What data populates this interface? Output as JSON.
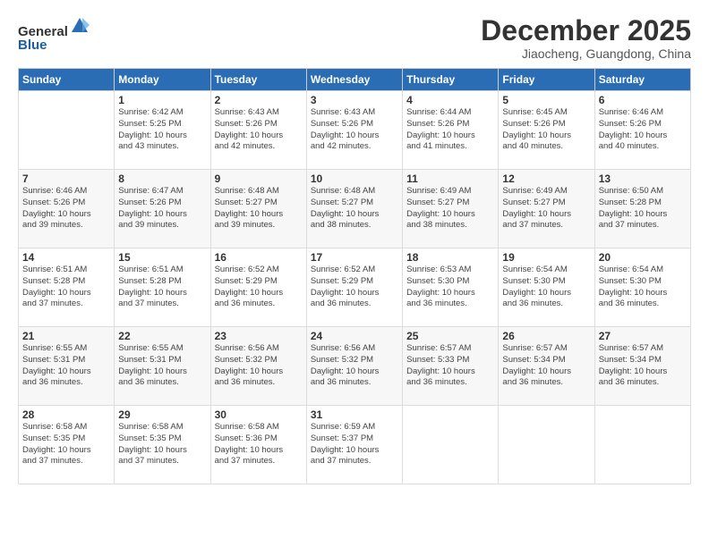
{
  "logo": {
    "general": "General",
    "blue": "Blue"
  },
  "header": {
    "month": "December 2025",
    "location": "Jiaocheng, Guangdong, China"
  },
  "weekdays": [
    "Sunday",
    "Monday",
    "Tuesday",
    "Wednesday",
    "Thursday",
    "Friday",
    "Saturday"
  ],
  "weeks": [
    [
      {
        "day": "",
        "info": ""
      },
      {
        "day": "1",
        "info": "Sunrise: 6:42 AM\nSunset: 5:25 PM\nDaylight: 10 hours\nand 43 minutes."
      },
      {
        "day": "2",
        "info": "Sunrise: 6:43 AM\nSunset: 5:26 PM\nDaylight: 10 hours\nand 42 minutes."
      },
      {
        "day": "3",
        "info": "Sunrise: 6:43 AM\nSunset: 5:26 PM\nDaylight: 10 hours\nand 42 minutes."
      },
      {
        "day": "4",
        "info": "Sunrise: 6:44 AM\nSunset: 5:26 PM\nDaylight: 10 hours\nand 41 minutes."
      },
      {
        "day": "5",
        "info": "Sunrise: 6:45 AM\nSunset: 5:26 PM\nDaylight: 10 hours\nand 40 minutes."
      },
      {
        "day": "6",
        "info": "Sunrise: 6:46 AM\nSunset: 5:26 PM\nDaylight: 10 hours\nand 40 minutes."
      }
    ],
    [
      {
        "day": "7",
        "info": "Sunrise: 6:46 AM\nSunset: 5:26 PM\nDaylight: 10 hours\nand 39 minutes."
      },
      {
        "day": "8",
        "info": "Sunrise: 6:47 AM\nSunset: 5:26 PM\nDaylight: 10 hours\nand 39 minutes."
      },
      {
        "day": "9",
        "info": "Sunrise: 6:48 AM\nSunset: 5:27 PM\nDaylight: 10 hours\nand 39 minutes."
      },
      {
        "day": "10",
        "info": "Sunrise: 6:48 AM\nSunset: 5:27 PM\nDaylight: 10 hours\nand 38 minutes."
      },
      {
        "day": "11",
        "info": "Sunrise: 6:49 AM\nSunset: 5:27 PM\nDaylight: 10 hours\nand 38 minutes."
      },
      {
        "day": "12",
        "info": "Sunrise: 6:49 AM\nSunset: 5:27 PM\nDaylight: 10 hours\nand 37 minutes."
      },
      {
        "day": "13",
        "info": "Sunrise: 6:50 AM\nSunset: 5:28 PM\nDaylight: 10 hours\nand 37 minutes."
      }
    ],
    [
      {
        "day": "14",
        "info": "Sunrise: 6:51 AM\nSunset: 5:28 PM\nDaylight: 10 hours\nand 37 minutes."
      },
      {
        "day": "15",
        "info": "Sunrise: 6:51 AM\nSunset: 5:28 PM\nDaylight: 10 hours\nand 37 minutes."
      },
      {
        "day": "16",
        "info": "Sunrise: 6:52 AM\nSunset: 5:29 PM\nDaylight: 10 hours\nand 36 minutes."
      },
      {
        "day": "17",
        "info": "Sunrise: 6:52 AM\nSunset: 5:29 PM\nDaylight: 10 hours\nand 36 minutes."
      },
      {
        "day": "18",
        "info": "Sunrise: 6:53 AM\nSunset: 5:30 PM\nDaylight: 10 hours\nand 36 minutes."
      },
      {
        "day": "19",
        "info": "Sunrise: 6:54 AM\nSunset: 5:30 PM\nDaylight: 10 hours\nand 36 minutes."
      },
      {
        "day": "20",
        "info": "Sunrise: 6:54 AM\nSunset: 5:30 PM\nDaylight: 10 hours\nand 36 minutes."
      }
    ],
    [
      {
        "day": "21",
        "info": "Sunrise: 6:55 AM\nSunset: 5:31 PM\nDaylight: 10 hours\nand 36 minutes."
      },
      {
        "day": "22",
        "info": "Sunrise: 6:55 AM\nSunset: 5:31 PM\nDaylight: 10 hours\nand 36 minutes."
      },
      {
        "day": "23",
        "info": "Sunrise: 6:56 AM\nSunset: 5:32 PM\nDaylight: 10 hours\nand 36 minutes."
      },
      {
        "day": "24",
        "info": "Sunrise: 6:56 AM\nSunset: 5:32 PM\nDaylight: 10 hours\nand 36 minutes."
      },
      {
        "day": "25",
        "info": "Sunrise: 6:57 AM\nSunset: 5:33 PM\nDaylight: 10 hours\nand 36 minutes."
      },
      {
        "day": "26",
        "info": "Sunrise: 6:57 AM\nSunset: 5:34 PM\nDaylight: 10 hours\nand 36 minutes."
      },
      {
        "day": "27",
        "info": "Sunrise: 6:57 AM\nSunset: 5:34 PM\nDaylight: 10 hours\nand 36 minutes."
      }
    ],
    [
      {
        "day": "28",
        "info": "Sunrise: 6:58 AM\nSunset: 5:35 PM\nDaylight: 10 hours\nand 37 minutes."
      },
      {
        "day": "29",
        "info": "Sunrise: 6:58 AM\nSunset: 5:35 PM\nDaylight: 10 hours\nand 37 minutes."
      },
      {
        "day": "30",
        "info": "Sunrise: 6:58 AM\nSunset: 5:36 PM\nDaylight: 10 hours\nand 37 minutes."
      },
      {
        "day": "31",
        "info": "Sunrise: 6:59 AM\nSunset: 5:37 PM\nDaylight: 10 hours\nand 37 minutes."
      },
      {
        "day": "",
        "info": ""
      },
      {
        "day": "",
        "info": ""
      },
      {
        "day": "",
        "info": ""
      }
    ]
  ]
}
